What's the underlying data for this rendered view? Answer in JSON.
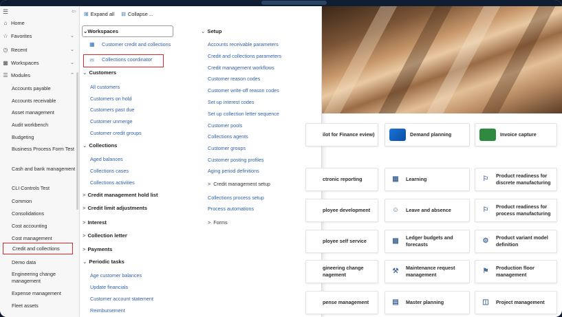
{
  "nav": {
    "top": [
      {
        "label": "Home",
        "icon": "home-icon"
      },
      {
        "label": "Favorites",
        "icon": "star-icon"
      },
      {
        "label": "Recent",
        "icon": "clock-icon"
      },
      {
        "label": "Workspaces",
        "icon": "workspaces-icon"
      },
      {
        "label": "Modules",
        "icon": "list-icon"
      }
    ],
    "modules": [
      "Accounts payable",
      "Accounts receivable",
      "Asset management",
      "Audit workbench",
      "Budgeting",
      "Business Process Form Test",
      "Cash and bank management",
      "CLI Controls Test",
      "Common",
      "Consolidations",
      "Cost accounting",
      "Cost management",
      "Credit and collections",
      "Demo data",
      "Engineering change management",
      "Expense management",
      "Fleet assets"
    ]
  },
  "panel": {
    "expand_all": "Expand all",
    "collapse": "Collapse ...",
    "left": {
      "workspaces_label": "Workspaces",
      "workspace_links": [
        "Customer credit and collections",
        "Collections coordinator"
      ],
      "customers_label": "Customers",
      "customers": [
        "All customers",
        "Customers on hold",
        "Customers past due",
        "Customer unmerge",
        "Customer credit groups"
      ],
      "collections_label": "Collections",
      "collections": [
        "Aged balances",
        "Collections cases",
        "Collections activities"
      ],
      "collapsed": [
        "Credit management hold list",
        "Credit limit adjustments",
        "Interest",
        "Collection letter",
        "Payments"
      ],
      "periodic_label": "Periodic tasks",
      "periodic": [
        "Age customer balances",
        "Update financials",
        "Customer account statement",
        "Reimbursement"
      ]
    },
    "right": {
      "setup_label": "Setup",
      "setup": [
        "Accounts receivable parameters",
        "Credit and collections parameters",
        "Credit management workflows",
        "Customer reason codes",
        "Customer write-off reason codes",
        "Set up interest codes",
        "Set up collection letter sequence",
        "Customer pools",
        "Collections agents",
        "Customer groups",
        "Customer posting profiles",
        "Aging period definitions"
      ],
      "cm_setup": "Credit management setup",
      "process_links": [
        "Collections process setup",
        "Process automations"
      ],
      "forms": "Forms"
    }
  },
  "tiles": {
    "row1": [
      "ilot for Finance eview)",
      "Demand planning",
      "Invoice capture"
    ],
    "col1": [
      "ctronic reporting",
      "ployee development",
      "ployee self service",
      "gineering change nagement",
      "pense management"
    ],
    "col2": [
      "Learning",
      "Leave and absence",
      "Ledger budgets and forecasts",
      "Maintenance request management",
      "Master planning"
    ],
    "col3": [
      "Product readiness for discrete manufacturing",
      "Product readiness for process manufacturing",
      "Product variant model definition",
      "Production floor management",
      "Project management"
    ]
  },
  "colors": {
    "accent": "#2f6bbd",
    "highlight_box": "#d9262c",
    "link": "#2f5fa7"
  }
}
